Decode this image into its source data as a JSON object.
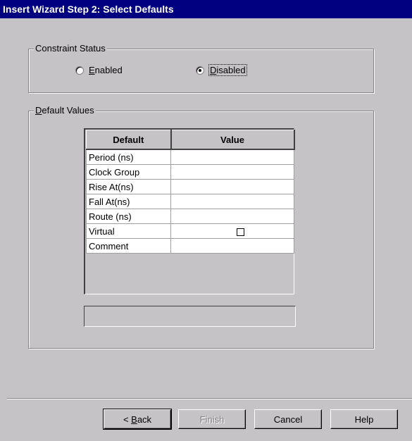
{
  "window": {
    "title": "Insert Wizard Step 2: Select Defaults"
  },
  "constraint_status": {
    "label": "Constraint Status",
    "options": [
      {
        "label_first": "E",
        "label_rest": "nabled",
        "selected": false
      },
      {
        "label_first": "D",
        "label_rest": "isabled",
        "selected": true
      }
    ]
  },
  "default_values": {
    "label_first": "D",
    "label_rest": "efault Values",
    "columns": [
      "Default",
      "Value"
    ],
    "rows": [
      {
        "name": "Period (ns)",
        "value": ""
      },
      {
        "name": "Clock Group",
        "value": ""
      },
      {
        "name": "Rise At(ns)",
        "value": ""
      },
      {
        "name": "Fall At(ns)",
        "value": ""
      },
      {
        "name": "Route (ns)",
        "value": ""
      },
      {
        "name": "Virtual",
        "value": "",
        "checkbox": true,
        "checked": false
      },
      {
        "name": "Comment",
        "value": ""
      }
    ],
    "status_text": ""
  },
  "buttons": {
    "back_prefix": "< ",
    "back_mnemonic": "B",
    "back_rest": "ack",
    "finish": "Finish",
    "cancel": "Cancel",
    "help": "Help"
  }
}
